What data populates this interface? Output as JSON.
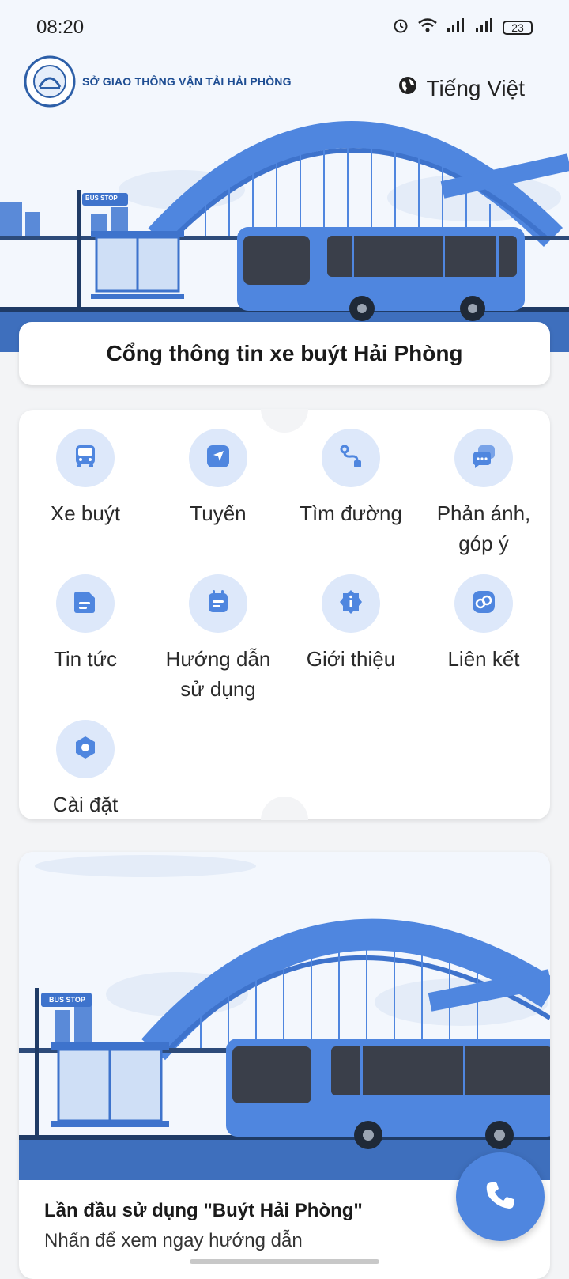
{
  "status_bar": {
    "time": "08:20",
    "battery": "23"
  },
  "header": {
    "logo_text": "SỞ GIAO THÔNG VẬN TẢI HẢI PHÒNG",
    "language": "Tiếng Việt",
    "bus_stop_sign": "BUS STOP"
  },
  "portal_title": "Cổng thông tin xe buýt Hải Phòng",
  "menu": {
    "items": [
      {
        "label": "Xe buýt",
        "icon": "bus-icon"
      },
      {
        "label": "Tuyến",
        "icon": "navigation-icon"
      },
      {
        "label": "Tìm đường",
        "icon": "route-icon"
      },
      {
        "label": "Phản ánh, góp ý",
        "icon": "chat-icon"
      },
      {
        "label": "Tin tức",
        "icon": "news-icon"
      },
      {
        "label": "Hướng dẫn sử dụng",
        "icon": "calendar-guide-icon"
      },
      {
        "label": "Giới thiệu",
        "icon": "info-icon"
      },
      {
        "label": "Liên kết",
        "icon": "link-icon"
      },
      {
        "label": "Cài đặt",
        "icon": "settings-icon"
      }
    ]
  },
  "guide": {
    "title": "Lần đầu sử dụng \"Buýt Hải Phòng\"",
    "subtitle": "Nhấn để xem ngay hướng dẫn",
    "bus_stop_sign": "BUS STOP"
  },
  "colors": {
    "primary": "#4f86df",
    "icon_bg": "#dde8fa",
    "dark_blue": "#1f4e93"
  }
}
